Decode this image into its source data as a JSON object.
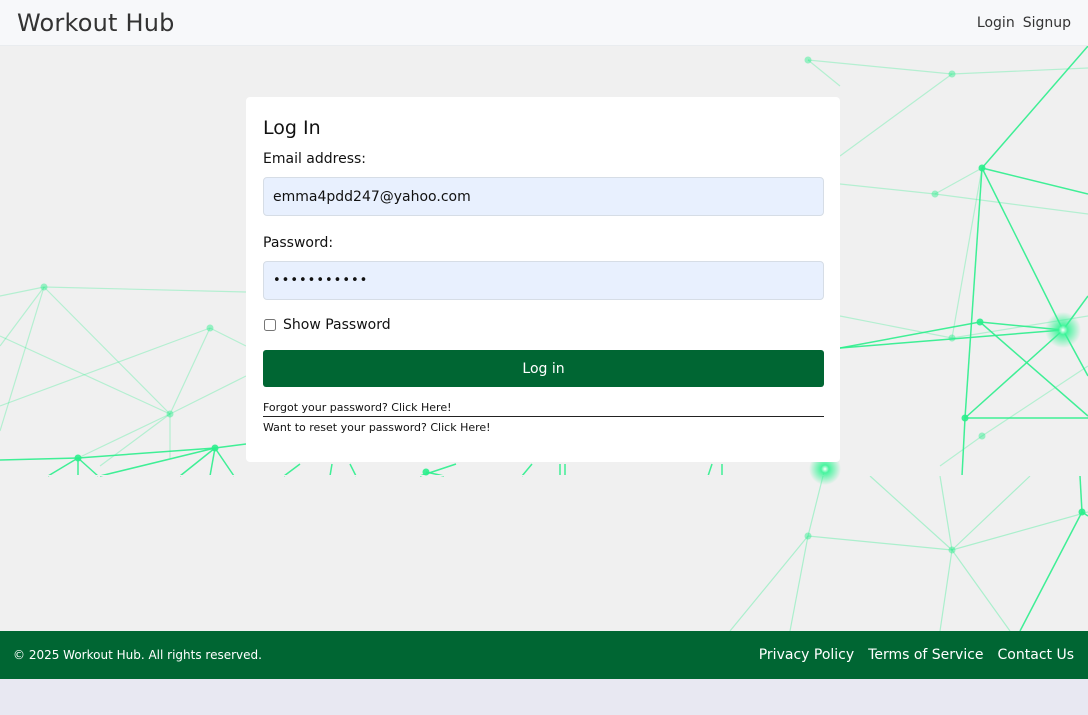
{
  "navbar": {
    "brand": "Workout Hub",
    "links": [
      {
        "label": "Login"
      },
      {
        "label": "Signup"
      }
    ]
  },
  "login_form": {
    "title": "Log In",
    "email_label": "Email address:",
    "email_value": "emma4pdd247@yahoo.com",
    "password_label": "Password:",
    "password_value": "•••••••••••",
    "show_password_label": "Show Password",
    "submit_label": "Log in",
    "forgot_link": "Forgot your password? Click Here!",
    "reset_link": "Want to reset your password? Click Here!"
  },
  "footer": {
    "copyright": "© 2025 Workout Hub. All rights reserved.",
    "links": [
      {
        "label": "Privacy Policy"
      },
      {
        "label": "Terms of Service"
      },
      {
        "label": "Contact Us"
      }
    ]
  },
  "colors": {
    "primary": "#006633",
    "network_line": "#2bee8c",
    "input_bg": "#e8f0fe",
    "page_bg": "#f0f0f0"
  }
}
